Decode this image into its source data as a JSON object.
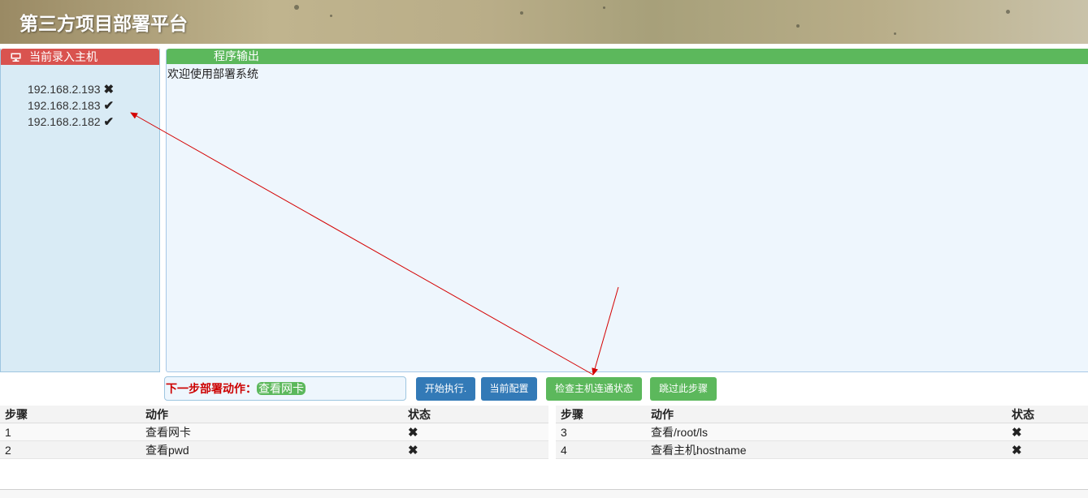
{
  "header": {
    "title": "第三方项目部署平台"
  },
  "hosts_panel": {
    "title": "当前录入主机",
    "icon": "desktop-icon",
    "hosts": [
      {
        "ip": "192.168.2.193",
        "status": "✖"
      },
      {
        "ip": "192.168.2.183",
        "status": "✔"
      },
      {
        "ip": "192.168.2.182",
        "status": "✔"
      }
    ]
  },
  "output_panel": {
    "title": "程序输出",
    "text": "欢迎使用部署系统"
  },
  "next_step": {
    "label": "下一步部署动作：",
    "value": "查看网卡"
  },
  "buttons": {
    "start": "开始执行.",
    "config": "当前配置",
    "check": "检查主机连通状态",
    "skip": "跳过此步骤"
  },
  "steps_table_left": {
    "headers": [
      "步骤",
      "动作",
      "状态"
    ],
    "rows": [
      {
        "step": "1",
        "action": "查看网卡",
        "status": "✖"
      },
      {
        "step": "2",
        "action": "查看pwd",
        "status": "✖"
      }
    ]
  },
  "steps_table_right": {
    "headers": [
      "步骤",
      "动作",
      "状态"
    ],
    "rows": [
      {
        "step": "3",
        "action": "查看/root/ls",
        "status": "✖"
      },
      {
        "step": "4",
        "action": "查看主机hostname",
        "status": "✖"
      }
    ]
  },
  "colors": {
    "danger": "#d9534f",
    "success": "#5cb85c",
    "primary": "#337ab7",
    "annotation_arrow": "#d40000"
  }
}
